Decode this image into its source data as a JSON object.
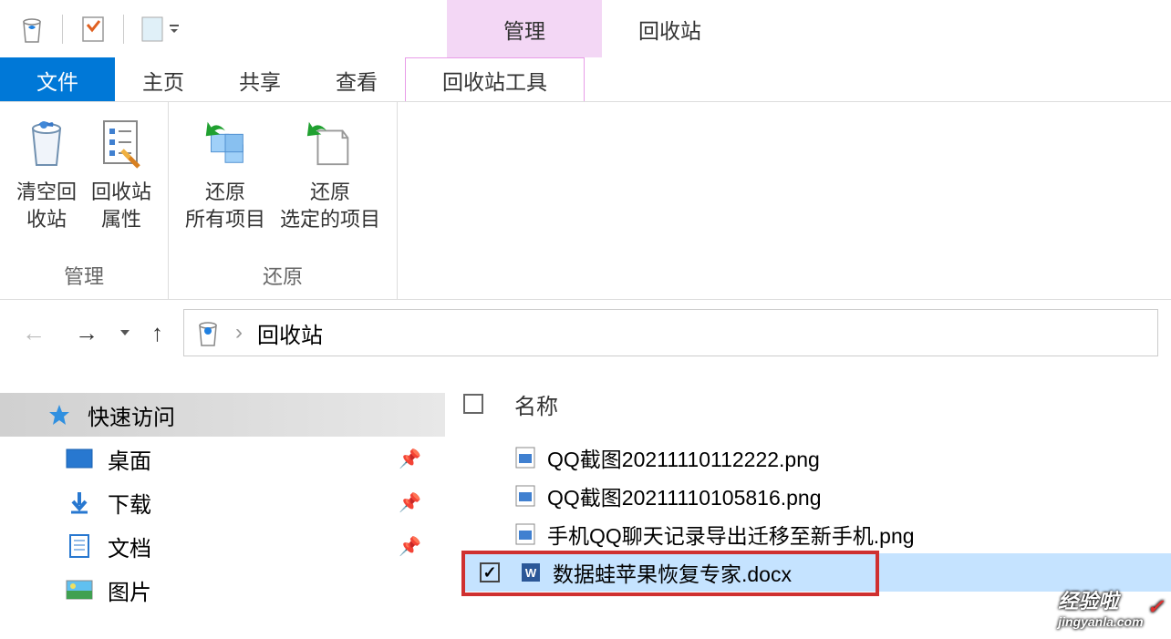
{
  "titlebar": {
    "context_tab": "管理",
    "window_title": "回收站"
  },
  "tabs": {
    "file": "文件",
    "home": "主页",
    "share": "共享",
    "view": "查看",
    "recycle_tools": "回收站工具"
  },
  "ribbon": {
    "manage": {
      "empty": "清空回\n收站",
      "properties": "回收站\n属性",
      "group_label": "管理"
    },
    "restore": {
      "restore_all": "还原\n所有项目",
      "restore_selected": "还原\n选定的项目",
      "group_label": "还原"
    }
  },
  "address": {
    "location": "回收站"
  },
  "nav_pane": {
    "quick_access": "快速访问",
    "desktop": "桌面",
    "downloads": "下载",
    "documents": "文档",
    "pictures": "图片"
  },
  "file_list": {
    "header_name": "名称",
    "items": [
      {
        "name": "QQ截图20211110112222.png",
        "type": "png",
        "selected": false
      },
      {
        "name": "QQ截图20211110105816.png",
        "type": "png",
        "selected": false
      },
      {
        "name": "手机QQ聊天记录导出迁移至新手机.png",
        "type": "png",
        "selected": false
      },
      {
        "name": "数据蛙苹果恢复专家.docx",
        "type": "docx",
        "selected": true
      }
    ]
  },
  "watermark": {
    "text": "经验啦",
    "url": "jingyanla.com"
  }
}
